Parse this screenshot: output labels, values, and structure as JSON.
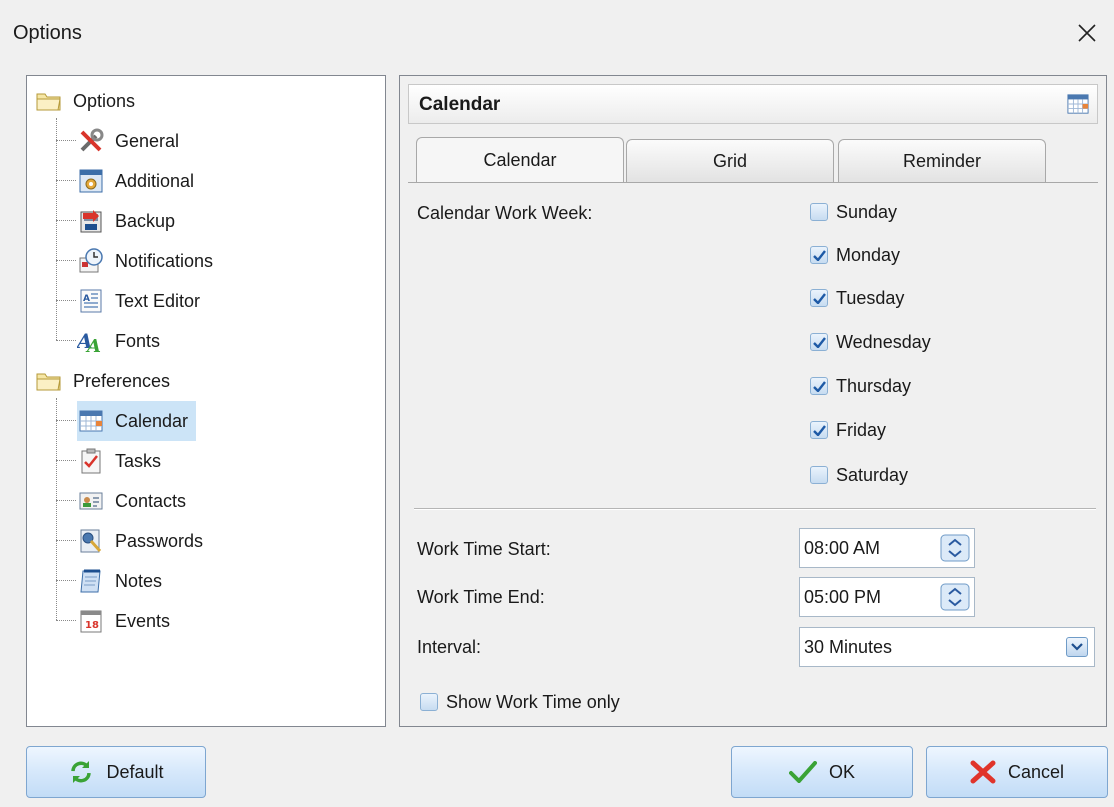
{
  "window": {
    "title": "Options",
    "close_symbol": "✕"
  },
  "tree": {
    "groups": [
      {
        "label": "Options",
        "icon": "folder-icon",
        "items": [
          {
            "label": "General",
            "icon": "tools-icon"
          },
          {
            "label": "Additional",
            "icon": "gear-window-icon"
          },
          {
            "label": "Backup",
            "icon": "backup-icon"
          },
          {
            "label": "Notifications",
            "icon": "notification-clock-icon"
          },
          {
            "label": "Text Editor",
            "icon": "text-editor-icon"
          },
          {
            "label": "Fonts",
            "icon": "fonts-icon"
          }
        ]
      },
      {
        "label": "Preferences",
        "icon": "folder-icon",
        "items": [
          {
            "label": "Calendar",
            "icon": "calendar-icon",
            "selected": true
          },
          {
            "label": "Tasks",
            "icon": "tasks-checklist-icon"
          },
          {
            "label": "Contacts",
            "icon": "contact-card-icon"
          },
          {
            "label": "Passwords",
            "icon": "password-key-icon"
          },
          {
            "label": "Notes",
            "icon": "notepad-icon"
          },
          {
            "label": "Events",
            "icon": "event-date-icon",
            "date_glyph": "18"
          }
        ]
      }
    ]
  },
  "panel": {
    "title": "Calendar",
    "tabs": [
      {
        "label": "Calendar",
        "active": true
      },
      {
        "label": "Grid",
        "active": false
      },
      {
        "label": "Reminder",
        "active": false
      }
    ],
    "work_week_label": "Calendar Work Week:",
    "days": [
      {
        "label": "Sunday",
        "checked": false
      },
      {
        "label": "Monday",
        "checked": true
      },
      {
        "label": "Tuesday",
        "checked": true
      },
      {
        "label": "Wednesday",
        "checked": true
      },
      {
        "label": "Thursday",
        "checked": true
      },
      {
        "label": "Friday",
        "checked": true
      },
      {
        "label": "Saturday",
        "checked": false
      }
    ],
    "work_time_start": {
      "label": "Work Time Start:",
      "value": "08:00 AM"
    },
    "work_time_end": {
      "label": "Work Time End:",
      "value": "05:00 PM"
    },
    "interval": {
      "label": "Interval:",
      "value": "30 Minutes"
    },
    "show_work_time_only": {
      "label": "Show Work Time only",
      "checked": false
    }
  },
  "buttons": {
    "default": "Default",
    "ok": "OK",
    "cancel": "Cancel"
  },
  "colors": {
    "accent": "#2a6fb5",
    "selection": "#cce4f7",
    "ok_green": "#3aa336",
    "cancel_red": "#e0342b"
  }
}
